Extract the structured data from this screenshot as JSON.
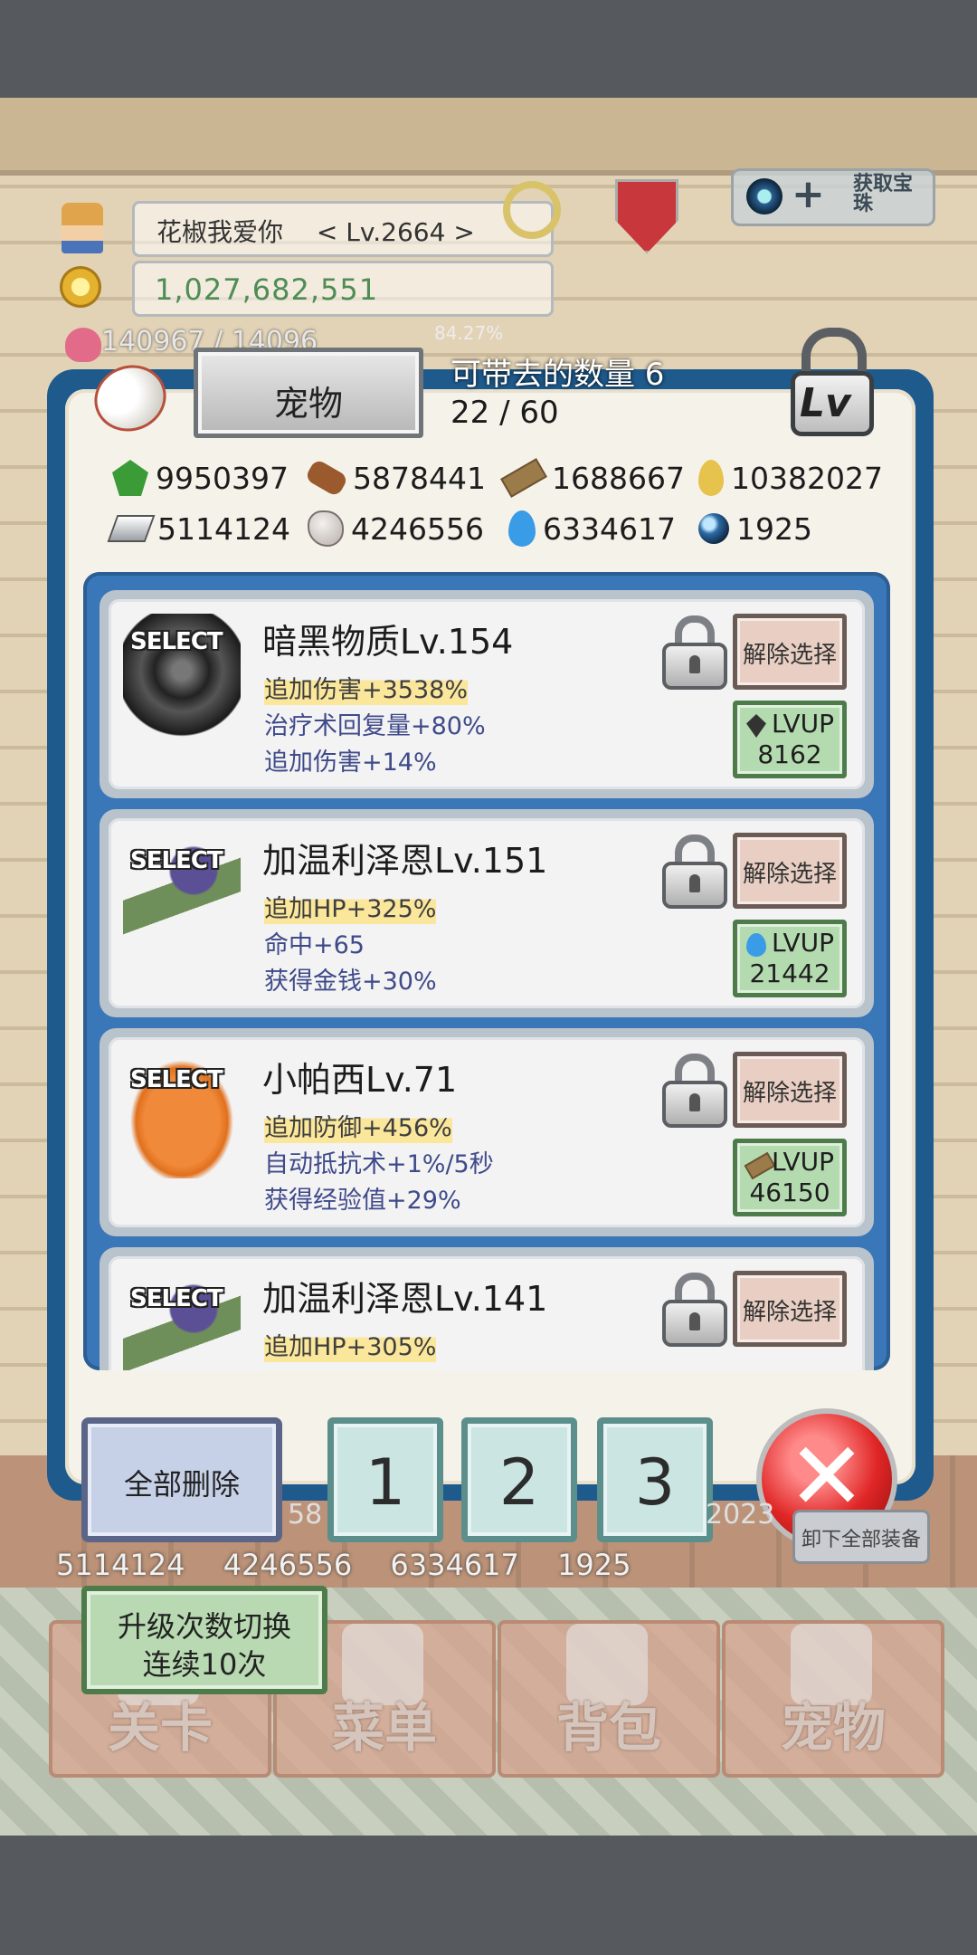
{
  "player": {
    "name_level": "花椒我爱你 　< Lv.2664 >",
    "gold": "1,027,682,551",
    "hp_text": "140967 / 14096",
    "exp_percent": "84.27%",
    "get_gem_label": "获取宝珠"
  },
  "panel": {
    "title": "宠物",
    "carry_label": "可带去的数量 6",
    "count": "22 / 60",
    "lv_lock_label": "Lv"
  },
  "resources": [
    {
      "icon": "leaf-icon",
      "value": "9950397"
    },
    {
      "icon": "log-icon",
      "value": "5878441"
    },
    {
      "icon": "plank-icon",
      "value": "1688667"
    },
    {
      "icon": "drop-icon",
      "value": "10382027"
    },
    {
      "icon": "ingot-icon",
      "value": "5114124"
    },
    {
      "icon": "rock-icon",
      "value": "4246556"
    },
    {
      "icon": "fire-icon",
      "value": "6334617"
    },
    {
      "icon": "orb-icon",
      "value": "1925"
    }
  ],
  "pets": [
    {
      "select": "SELECT",
      "name": "暗黑物质Lv.154",
      "stats": [
        "追加伤害+3538%",
        "治疗术回复量+80%",
        "追加伤害+14%"
      ],
      "deselect": "解除选择",
      "lvup_label": "LVUP",
      "lvup_cost": "8162",
      "lvup_icon": "gem-icon"
    },
    {
      "select": "SELECT",
      "name": "加温利泽恩Lv.151",
      "stats": [
        "追加HP+325%",
        "命中+65",
        "获得金钱+30%"
      ],
      "deselect": "解除选择",
      "lvup_label": "LVUP",
      "lvup_cost": "21442",
      "lvup_icon": "fire-icon"
    },
    {
      "select": "SELECT",
      "name": "小帕西Lv.71",
      "stats": [
        "追加防御+456%",
        "自动抵抗术+1%/5秒",
        "获得经验值+29%"
      ],
      "deselect": "解除选择",
      "lvup_label": "LVUP",
      "lvup_cost": "46150",
      "lvup_icon": "plank-icon"
    },
    {
      "select": "SELECT",
      "name": "加温利泽恩Lv.141",
      "stats": [
        "追加HP+305%"
      ],
      "deselect": "解除选择"
    }
  ],
  "controls": {
    "delete_all": "全部删除",
    "slots": [
      "1",
      "2",
      "3"
    ],
    "close": "✕"
  },
  "lower_hud": {
    "resource_line": "5114124 　4246556 　6334617 　1925",
    "fragment": "58",
    "fragment2": "2023",
    "equip_label": "卸下全部装备",
    "upgrade_line1": "升级次数切换",
    "upgrade_line2": "连续10次",
    "nav": [
      "关卡",
      "菜单",
      "背包",
      "宠物"
    ]
  }
}
